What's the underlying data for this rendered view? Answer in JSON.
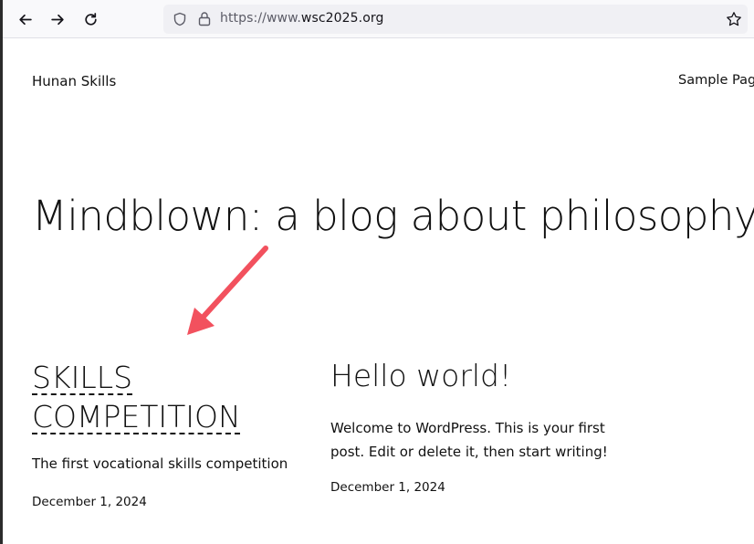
{
  "browser": {
    "url_prefix": "https://www.",
    "url_domain": "wsc2025.org",
    "icons": [
      "back-arrow-icon",
      "forward-arrow-icon",
      "reload-icon",
      "shield-icon",
      "lock-icon",
      "star-icon"
    ]
  },
  "site": {
    "title": "Hunan Skills",
    "nav": [
      "Sample Page"
    ]
  },
  "hero": {
    "heading": "Mindblown: a blog about philosophy."
  },
  "posts": [
    {
      "title": "SKILLS COMPETITION",
      "excerpt": "The first vocational skills competition",
      "date": "December 1, 2024"
    },
    {
      "title": "Hello world!",
      "excerpt": "Welcome to WordPress. This is your first post. Edit or delete it, then start writing!",
      "date": "December 1, 2024"
    }
  ],
  "colors": {
    "annotation_arrow": "#f2515e",
    "toolbar_bg": "#f9f9fb",
    "urlbar_bg": "#f0f0f4"
  }
}
